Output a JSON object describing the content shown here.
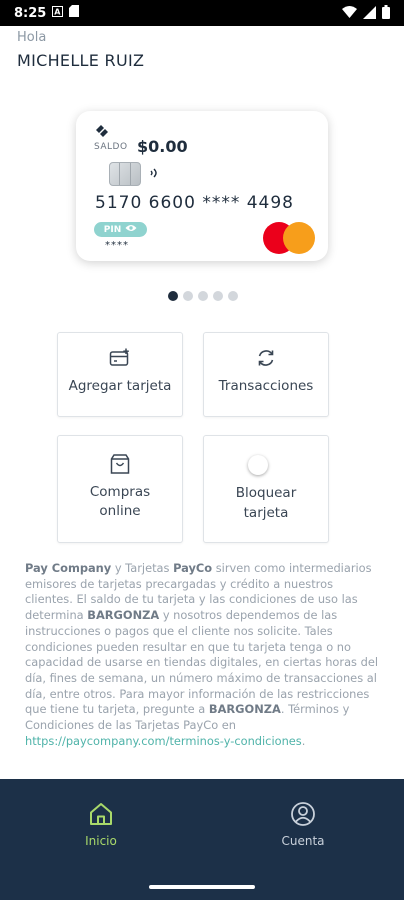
{
  "status_bar": {
    "time": "8:25"
  },
  "greeting": {
    "hello": "Hola",
    "name": "MICHELLE RUIZ"
  },
  "card": {
    "saldo_label": "SALDO",
    "saldo_value": "$0.00",
    "number": "5170 6600 **** 4498",
    "pin_label": "PIN",
    "pin_masked": "****",
    "brand_icon": "mastercard-logo"
  },
  "carousel": {
    "total": 5,
    "active": 1
  },
  "tiles": [
    {
      "label": "Agregar tarjeta",
      "icon": "add-card-icon"
    },
    {
      "label": "Transacciones",
      "icon": "refresh-icon"
    },
    {
      "label_line1": "Compras",
      "label_line2": "online",
      "icon": "shopping-bag-icon"
    },
    {
      "label_line1": "Bloquear",
      "label_line2": "tarjeta",
      "icon": "toggle-switch",
      "toggle_on": true
    }
  ],
  "disclaimer": {
    "company": "Pay Company",
    "t1": " y Tarjetas ",
    "payco": "PayCo",
    "t2": " sirven como intermediarios emisores de tarjetas precargadas y crédito a nuestros clientes. El saldo de tu tarjeta y las condiciones de uso las determina ",
    "bargonza1": "BARGONZA",
    "t3": " y nosotros dependemos de las instrucciones o pagos que el cliente nos solicite. Tales condiciones pueden resultar en que tu tarjeta tenga o no capacidad de usarse en tiendas digitales, en ciertas horas del día, fines de semana, un número máximo de transacciones al día, entre otros. Para mayor información de las restricciones que tiene tu tarjeta, pregunte a ",
    "bargonza2": "BARGONZA",
    "t4": ". Términos y Condiciones de las Tarjetas PayCo en ",
    "link": "https://paycompany.com/terminos-y-condiciones",
    "t5": "."
  },
  "bottom_nav": {
    "items": [
      {
        "label": "Inicio",
        "icon": "home-icon",
        "active": true
      },
      {
        "label": "Cuenta",
        "icon": "account-circle-icon",
        "active": false
      }
    ]
  },
  "colors": {
    "accent": "#8fd3cf",
    "nav_bg": "#1c3048",
    "nav_active": "#a9d96a",
    "link": "#4fb3a9"
  }
}
